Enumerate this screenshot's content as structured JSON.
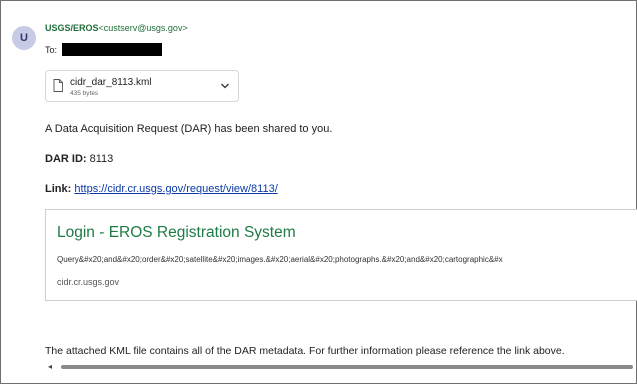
{
  "sender": {
    "initial": "U",
    "name": "USGS/EROS",
    "email": "<custserv@usgs.gov>"
  },
  "recipient": {
    "label": "To:"
  },
  "attachment": {
    "filename": "cidr_dar_8113.kml",
    "size": "435 bytes"
  },
  "body": {
    "intro": "A Data Acquisition Request (DAR) has been shared to you.",
    "dar_label": "DAR ID:",
    "dar_value": "8113",
    "link_label": "Link:",
    "link_url": "https://cidr.cr.usgs.gov/request/view/8113/",
    "footer": "The attached KML file contains all of the DAR metadata. For further information please reference the link above."
  },
  "preview_card": {
    "title": "Login - EROS Registration System",
    "description": "Query&#x20;and&#x20;order&#x20;satellite&#x20;images.&#x20;aerial&#x20;photographs.&#x20;and&#x20;cartographic&#x",
    "domain": "cidr.cr.usgs.gov"
  }
}
